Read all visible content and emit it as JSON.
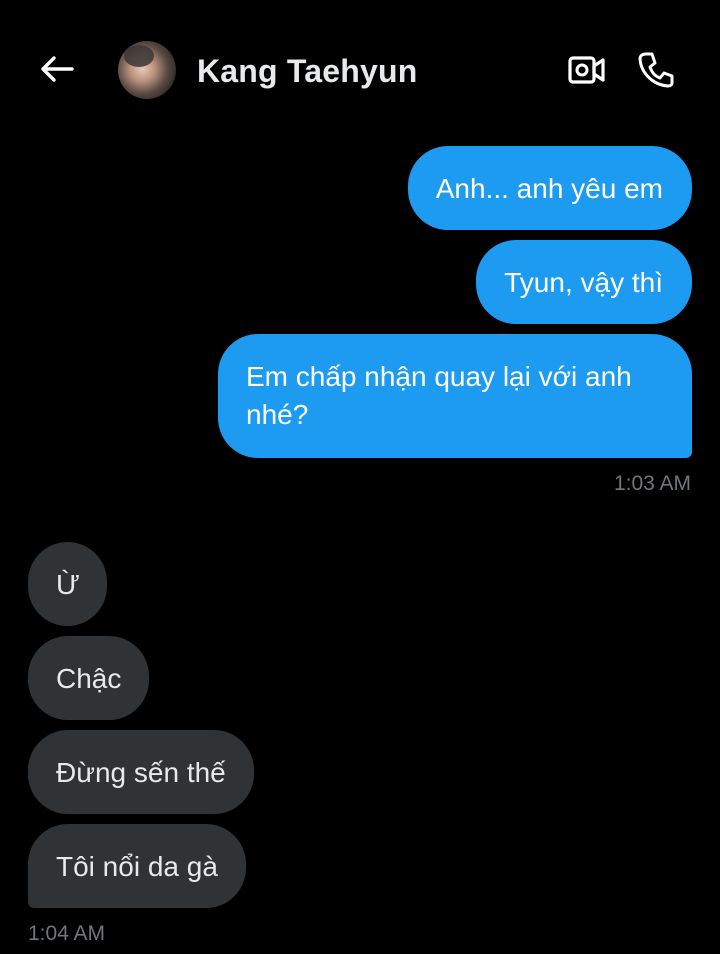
{
  "header": {
    "contact_name": "Kang Taehyun",
    "icons": [
      "back-arrow-icon",
      "avatar",
      "video-camera-icon",
      "phone-icon"
    ]
  },
  "messages_out": [
    {
      "text": "Anh... anh yêu em"
    },
    {
      "text": "Tyun, vậy thì"
    },
    {
      "text": "Em chấp nhận quay lại với anh nhé?"
    }
  ],
  "timestamp_out": "1:03 AM",
  "messages_in": [
    {
      "text": "Ừ"
    },
    {
      "text": "Chậc"
    },
    {
      "text": "Đừng sến thế"
    },
    {
      "text": "Tôi nổi da gà"
    }
  ],
  "timestamp_in": "1:04 AM",
  "colors": {
    "background": "#000000",
    "outgoing_bubble": "#1d9bf0",
    "incoming_bubble": "#2f3336",
    "timestamp": "#71767b"
  }
}
